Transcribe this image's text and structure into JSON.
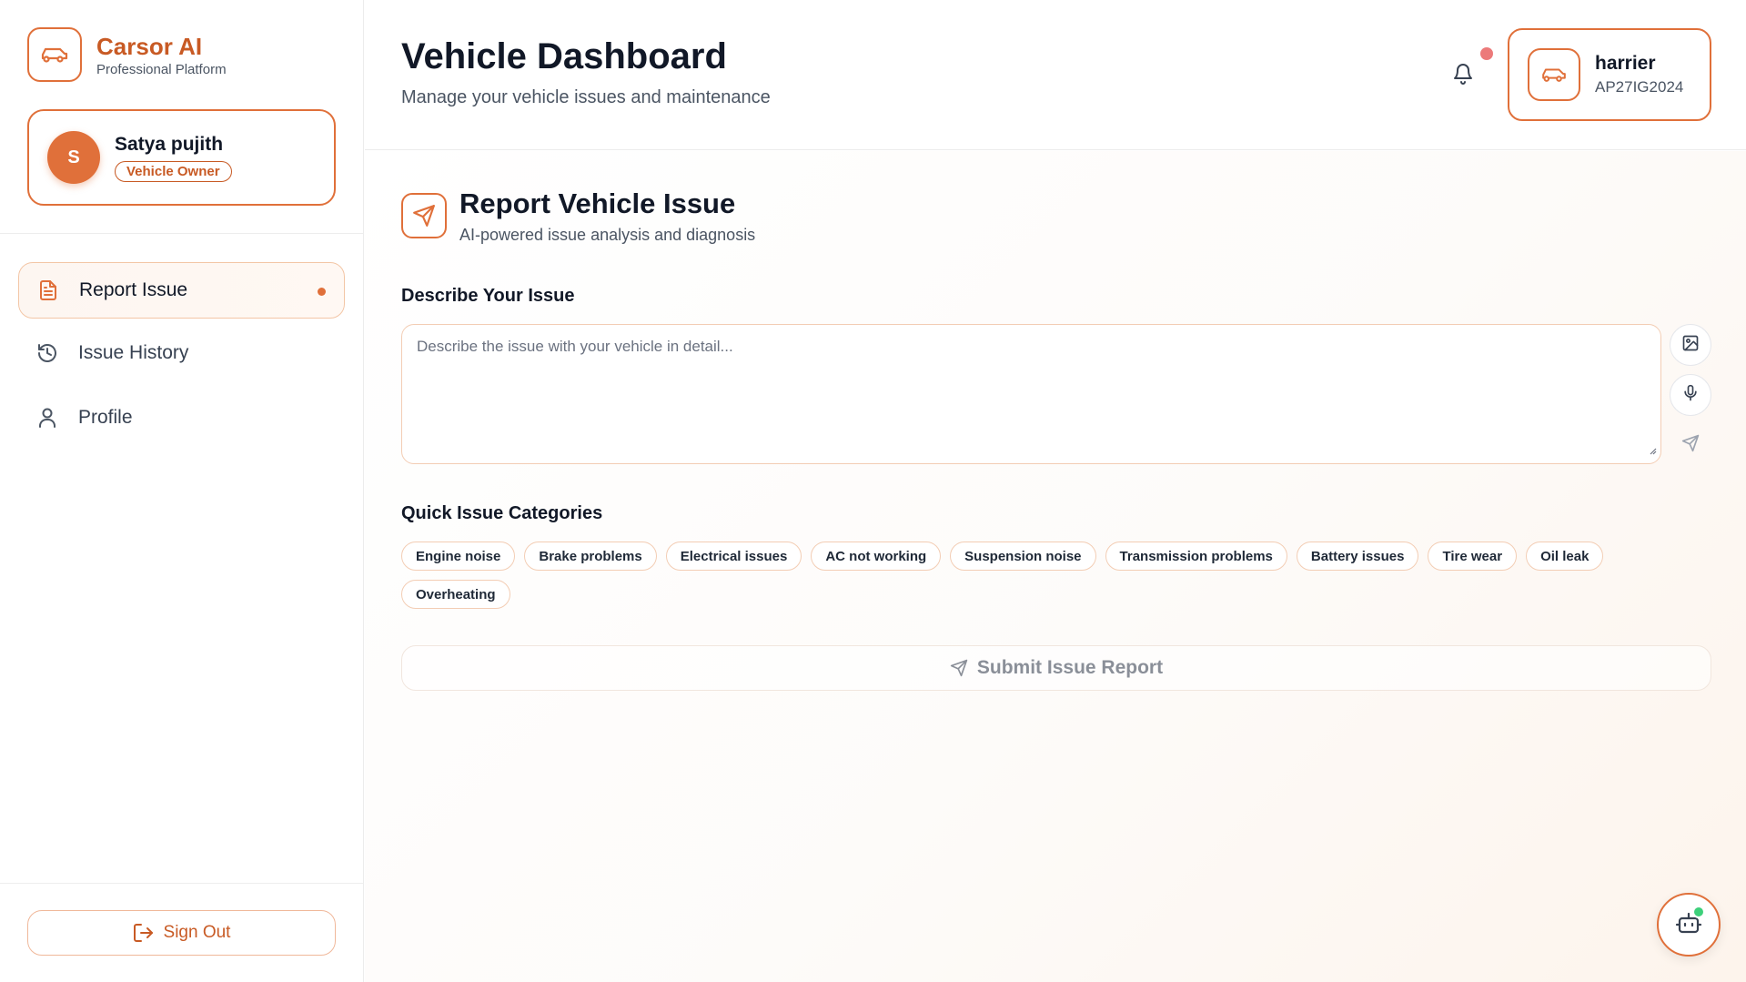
{
  "brand": {
    "name": "Carsor AI",
    "subtitle": "Professional Platform"
  },
  "user": {
    "initial": "S",
    "name": "Satya pujith",
    "role": "Vehicle Owner"
  },
  "nav": {
    "items": [
      {
        "label": "Report Issue",
        "icon": "document-icon",
        "active": true
      },
      {
        "label": "Issue History",
        "icon": "history-icon",
        "active": false
      },
      {
        "label": "Profile",
        "icon": "user-icon",
        "active": false
      }
    ]
  },
  "signout": {
    "label": "Sign Out"
  },
  "header": {
    "title": "Vehicle Dashboard",
    "subtitle": "Manage your vehicle issues and maintenance"
  },
  "vehicle": {
    "name": "harrier",
    "plate": "AP27IG2024"
  },
  "report": {
    "title": "Report Vehicle Issue",
    "subtitle": "AI-powered issue analysis and diagnosis",
    "describe_label": "Describe Your Issue",
    "placeholder": "Describe the issue with your vehicle in detail...",
    "categories_label": "Quick Issue Categories",
    "categories": [
      "Engine noise",
      "Brake problems",
      "Electrical issues",
      "AC not working",
      "Suspension noise",
      "Transmission problems",
      "Battery issues",
      "Tire wear",
      "Oil leak",
      "Overheating"
    ],
    "submit_label": "Submit Issue Report"
  },
  "colors": {
    "accent": "#e0703a",
    "accent_dark": "#c85a24",
    "online": "#3dd07a",
    "notification": "#ec7a7a"
  }
}
